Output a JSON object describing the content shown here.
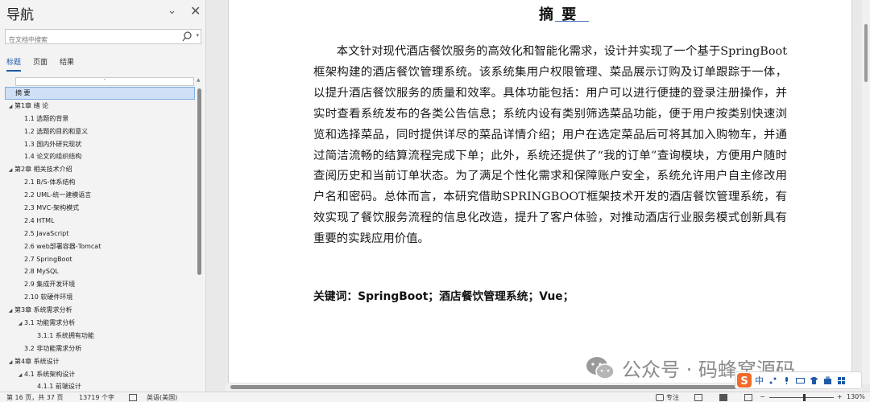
{
  "nav": {
    "title": "导航",
    "search_placeholder": "在文档中搜索",
    "tabs": [
      "标题",
      "页面",
      "结果"
    ],
    "items": [
      {
        "label": "摘  要",
        "level": 0,
        "tri": "",
        "selected": true
      },
      {
        "label": "第1章  绪  论",
        "level": 0,
        "tri": "◢"
      },
      {
        "label": "1.1  选题的背景",
        "level": 1,
        "tri": ""
      },
      {
        "label": "1.2  选题的目的和意义",
        "level": 1,
        "tri": ""
      },
      {
        "label": "1.3  国内外研究现状",
        "level": 1,
        "tri": ""
      },
      {
        "label": "1.4  论文的组织结构",
        "level": 1,
        "tri": ""
      },
      {
        "label": "第2章  相关技术介绍",
        "level": 0,
        "tri": "◢"
      },
      {
        "label": "2.1  B/S-体系结构",
        "level": 1,
        "tri": ""
      },
      {
        "label": "2.2  UML-统一建模语言",
        "level": 1,
        "tri": ""
      },
      {
        "label": "2.3  MVC-架构模式",
        "level": 1,
        "tri": ""
      },
      {
        "label": "2.4  HTML",
        "level": 1,
        "tri": ""
      },
      {
        "label": "2.5  JavaScript",
        "level": 1,
        "tri": ""
      },
      {
        "label": "2.6  web部署容器-Tomcat",
        "level": 1,
        "tri": ""
      },
      {
        "label": "2.7 SpringBoot",
        "level": 1,
        "tri": ""
      },
      {
        "label": "2.8   MySQL",
        "level": 1,
        "tri": ""
      },
      {
        "label": "2.9   集成开发环境",
        "level": 1,
        "tri": ""
      },
      {
        "label": "2.10   软硬件环境",
        "level": 1,
        "tri": ""
      },
      {
        "label": "第3章  系统需求分析",
        "level": 0,
        "tri": "◢"
      },
      {
        "label": "3.1  功能需求分析",
        "level": 1,
        "tri": "◢"
      },
      {
        "label": "3.1.1  系统拥有功能",
        "level": 2,
        "tri": ""
      },
      {
        "label": "3.2  非功能需求分析",
        "level": 1,
        "tri": ""
      },
      {
        "label": "第4章  系统设计",
        "level": 0,
        "tri": "◢"
      },
      {
        "label": "4.1  系统架构设计",
        "level": 1,
        "tri": "◢"
      },
      {
        "label": "4.1.1  前端设计",
        "level": 2,
        "tri": ""
      }
    ]
  },
  "doc": {
    "title": "摘    要",
    "body": "本文针对现代酒店餐饮服务的高效化和智能化需求，设计并实现了一个基于SpringBoot框架构建的酒店餐饮管理系统。该系统集用户权限管理、菜品展示订购及订单跟踪于一体，以提升酒店餐饮服务的质量和效率。具体功能包括：用户可以进行便捷的登录注册操作，并实时查看系统发布的各类公告信息；系统内设有类别筛选菜品功能，便于用户按类别快速浏览和选择菜品，同时提供详尽的菜品详情介绍；用户在选定菜品后可将其加入购物车，并通过简洁流畅的结算流程完成下单；此外，系统还提供了“我的订单”查询模块，方便用户随时查阅历史和当前订单状态。为了满足个性化需求和保障账户安全，系统允许用户自主修改用户名和密码。总体而言，本研究借助SPRINGBOOT框架技术开发的酒店餐饮管理系统，有效实现了餐饮服务流程的信息化改造，提升了客户体验，对推动酒店行业服务模式创新具有重要的实践应用价值。",
    "keywords": "关键词：SpringBoot；酒店餐饮管理系统；Vue；"
  },
  "watermark": "公众号 · 码蜂窝源码",
  "ime": {
    "lang": "中"
  },
  "status": {
    "page": "第 16 页，共 37 页",
    "words": "13719 个字",
    "language": "英语(美国)",
    "focus": "专注",
    "zoom": "130%",
    "zoom_minus": "−",
    "zoom_plus": "+"
  }
}
